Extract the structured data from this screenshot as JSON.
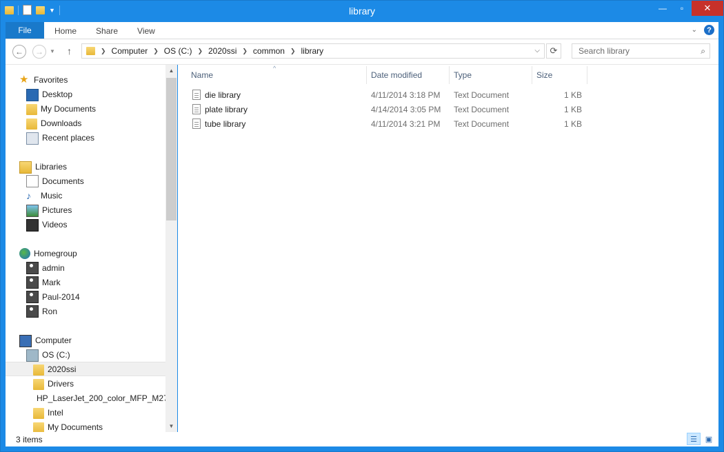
{
  "window": {
    "title": "library"
  },
  "ribbon": {
    "file_tab": "File",
    "tabs": [
      "Home",
      "Share",
      "View"
    ],
    "help": "?"
  },
  "address": {
    "crumbs": [
      "Computer",
      "OS (C:)",
      "2020ssi",
      "common",
      "library"
    ]
  },
  "search": {
    "placeholder": "Search library"
  },
  "nav": {
    "favorites": {
      "label": "Favorites",
      "items": [
        "Desktop",
        "My Documents",
        "Downloads",
        "Recent places"
      ]
    },
    "libraries": {
      "label": "Libraries",
      "items": [
        "Documents",
        "Music",
        "Pictures",
        "Videos"
      ]
    },
    "homegroup": {
      "label": "Homegroup",
      "items": [
        "admin",
        "Mark",
        "Paul-2014",
        "Ron"
      ]
    },
    "computer": {
      "label": "Computer",
      "drive": "OS (C:)",
      "folders": [
        "2020ssi",
        "Drivers",
        "HP_LaserJet_200_color_MFP_M27",
        "Intel",
        "My Documents"
      ],
      "selected": "2020ssi"
    }
  },
  "columns": {
    "name": "Name",
    "date": "Date modified",
    "type": "Type",
    "size": "Size"
  },
  "files": [
    {
      "name": "die library",
      "date": "4/11/2014 3:18 PM",
      "type": "Text Document",
      "size": "1 KB"
    },
    {
      "name": "plate library",
      "date": "4/14/2014 3:05 PM",
      "type": "Text Document",
      "size": "1 KB"
    },
    {
      "name": "tube library",
      "date": "4/11/2014 3:21 PM",
      "type": "Text Document",
      "size": "1 KB"
    }
  ],
  "status": {
    "count": "3 items"
  },
  "colors": {
    "titlebar": "#1c8ae6",
    "file_tab": "#1979ca",
    "close": "#c7312a"
  }
}
